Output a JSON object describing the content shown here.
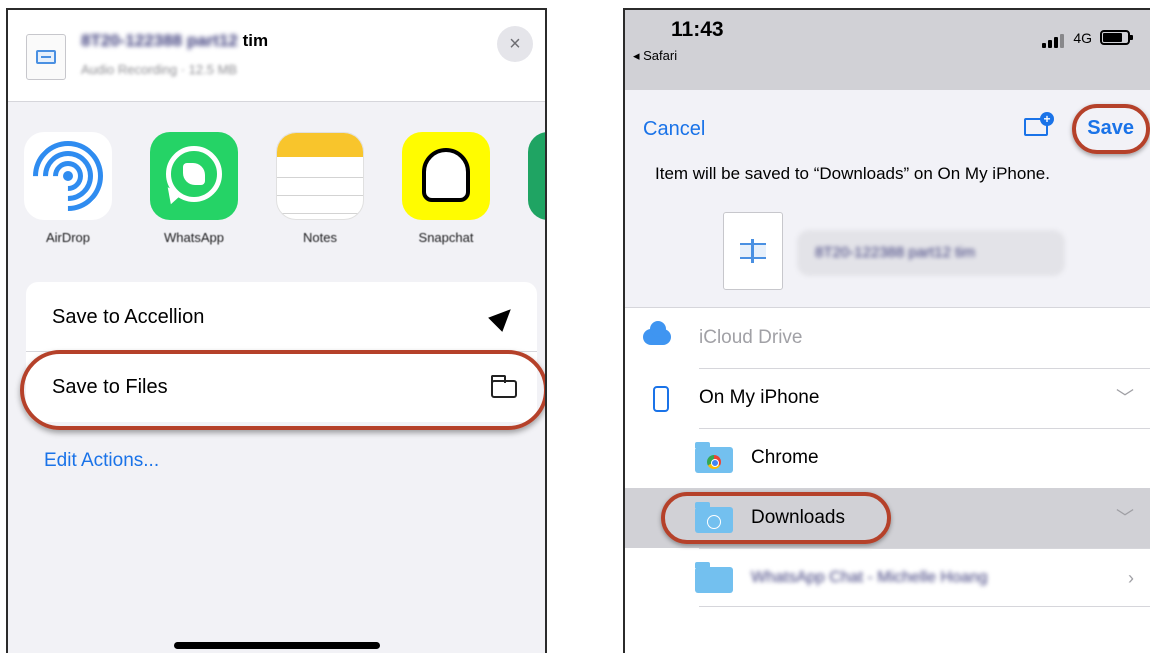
{
  "share_sheet": {
    "file_name_blurred": "8T20-122388 part12",
    "file_name_tail": "tim",
    "file_meta_blurred": "Audio Recording · 12.5 MB",
    "close_glyph": "×",
    "apps": [
      {
        "label": "AirDrop",
        "icon": "airdrop-icon"
      },
      {
        "label": "WhatsApp",
        "icon": "whatsapp-icon"
      },
      {
        "label": "Notes",
        "icon": "notes-icon"
      },
      {
        "label": "Snapchat",
        "icon": "snapchat-icon"
      }
    ],
    "actions": [
      {
        "label": "Save to Accellion",
        "icon": "location-arrow-icon"
      },
      {
        "label": "Save to Files",
        "icon": "folder-icon"
      }
    ],
    "edit_actions_label": "Edit Actions..."
  },
  "save_dialog": {
    "status": {
      "time": "11:43",
      "back_label": "◂ Safari",
      "network": "4G"
    },
    "cancel_label": "Cancel",
    "save_label": "Save",
    "save_note": "Item will be saved to “Downloads” on On My iPhone.",
    "filename_blurred": "8T20-122388 part12 tim",
    "locations": [
      {
        "label": "iCloud Drive",
        "icon": "icloud-icon"
      },
      {
        "label": "On My iPhone",
        "icon": "iphone-icon",
        "chevron": "﹀"
      },
      {
        "label": "Chrome",
        "icon": "chrome-folder-icon"
      },
      {
        "label": "Downloads",
        "icon": "downloads-folder-icon",
        "chevron": "﹀"
      },
      {
        "label": "WhatsApp Chat - Michelle Hoang",
        "icon": "folder-icon",
        "chevron": "›"
      }
    ]
  },
  "colors": {
    "accent": "#1a73e8",
    "highlight": "#b5412a",
    "folder": "#73c0ef"
  }
}
